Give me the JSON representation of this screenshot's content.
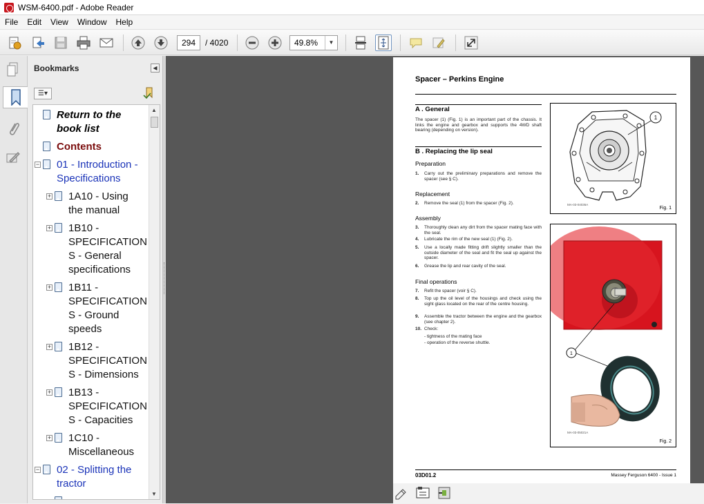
{
  "window": {
    "title": "WSM-6400.pdf - Adobe Reader"
  },
  "menu": [
    "File",
    "Edit",
    "View",
    "Window",
    "Help"
  ],
  "toolbar": {
    "page_current": "294",
    "page_total": "/ 4020",
    "zoom": "49.8%"
  },
  "bookmarks": {
    "title": "Bookmarks",
    "items": [
      {
        "label": "Return to the book list",
        "style": "bold-italic"
      },
      {
        "label": "Contents",
        "style": "bold-red"
      },
      {
        "label": "01 - Introduction - Specifications",
        "style": "link"
      },
      {
        "label": "1A10 - Using the manual",
        "style": "normal"
      },
      {
        "label": "1B10 - SPECIFICATIONS - General specifications",
        "style": "normal"
      },
      {
        "label": "1B11 - SPECIFICATIONS - Ground speeds",
        "style": "normal"
      },
      {
        "label": "1B12 - SPECIFICATIONS - Dimensions",
        "style": "normal"
      },
      {
        "label": "1B13 - SPECIFICATIONS - Capacities",
        "style": "normal"
      },
      {
        "label": "1C10 - Miscellaneous",
        "style": "normal"
      },
      {
        "label": "02 - Splitting the tractor",
        "style": "link"
      }
    ],
    "lines": [
      [
        "Return to the",
        "book list"
      ],
      [
        "Contents"
      ],
      [
        "01 - Introduction -",
        "Specifications"
      ],
      [
        "1A10 - Using",
        "the manual"
      ],
      [
        "1B10 -",
        "SPECIFICATION",
        "S - General",
        "specifications"
      ],
      [
        "1B11 -",
        "SPECIFICATION",
        "S - Ground",
        "speeds"
      ],
      [
        "1B12 -",
        "SPECIFICATION",
        "S - Dimensions"
      ],
      [
        "1B13 -",
        "SPECIFICATION",
        "S - Capacities"
      ],
      [
        "1C10 -",
        "Miscellaneous"
      ],
      [
        "02 - Splitting the",
        "tractor"
      ]
    ]
  },
  "document": {
    "title": "Spacer – Perkins Engine",
    "section_a": "A . General",
    "section_a_text": "The spacer (1) (Fig. 1) is an important part of the chassis. It links the engine and gearbox and supports the 4WD shaft bearing (depending on version).",
    "section_b": "B . Replacing the lip seal",
    "preparation": "Preparation",
    "step1_n": "1.",
    "step1": "Carry out the preliminary preparations and remove the spacer (see § C).",
    "replacement": "Replacement",
    "step2_n": "2.",
    "step2": "Remove the seal (1) from the spacer (Fig. 2).",
    "assembly": "Assembly",
    "step3_n": "3.",
    "step3": "Thoroughly clean any dirt from the spacer mating face with the seal.",
    "step4_n": "4.",
    "step4": "Lubricate the rim of the new seal (1) (Fig. 2).",
    "step5_n": "5.",
    "step5": "Use a locally made fitting drift slightly smaller than the outside diameter of the seal and fit the seal up against the spacer.",
    "step6_n": "6.",
    "step6": "Grease the lip and rear cavity of the seal.",
    "final_operations": "Final operations",
    "step7_n": "7.",
    "step7": "Refit the spacer (voir § C).",
    "step8_n": "8.",
    "step8": "Top up the oil level of the housings and check using the sight glass located on the rear of the centre housing.",
    "step9_n": "9.",
    "step9": "Assemble the tractor between the engine and the gearbox (see chapter 2).",
    "step10_n": "10.",
    "step10": "Check:",
    "check1": "- tightness of the mating face",
    "check2": "- operation of the reverse shuttle.",
    "fig1_caption": "Fig. 1",
    "fig1_callout": "1",
    "fig1_ref": "MA-03-04036A",
    "fig2_caption": "Fig. 2",
    "fig2_callout": "1",
    "fig2_ref": "MA-03-05021A",
    "footer_left": "03D01.2",
    "footer_right": "Massey Ferguson 6400 - Issue 1"
  },
  "colors": {
    "bookmark_link": "#1a33b8",
    "bookmark_contents": "#7a0c0c",
    "doc_background": "#575757",
    "fig2_red": "#d7141e"
  }
}
